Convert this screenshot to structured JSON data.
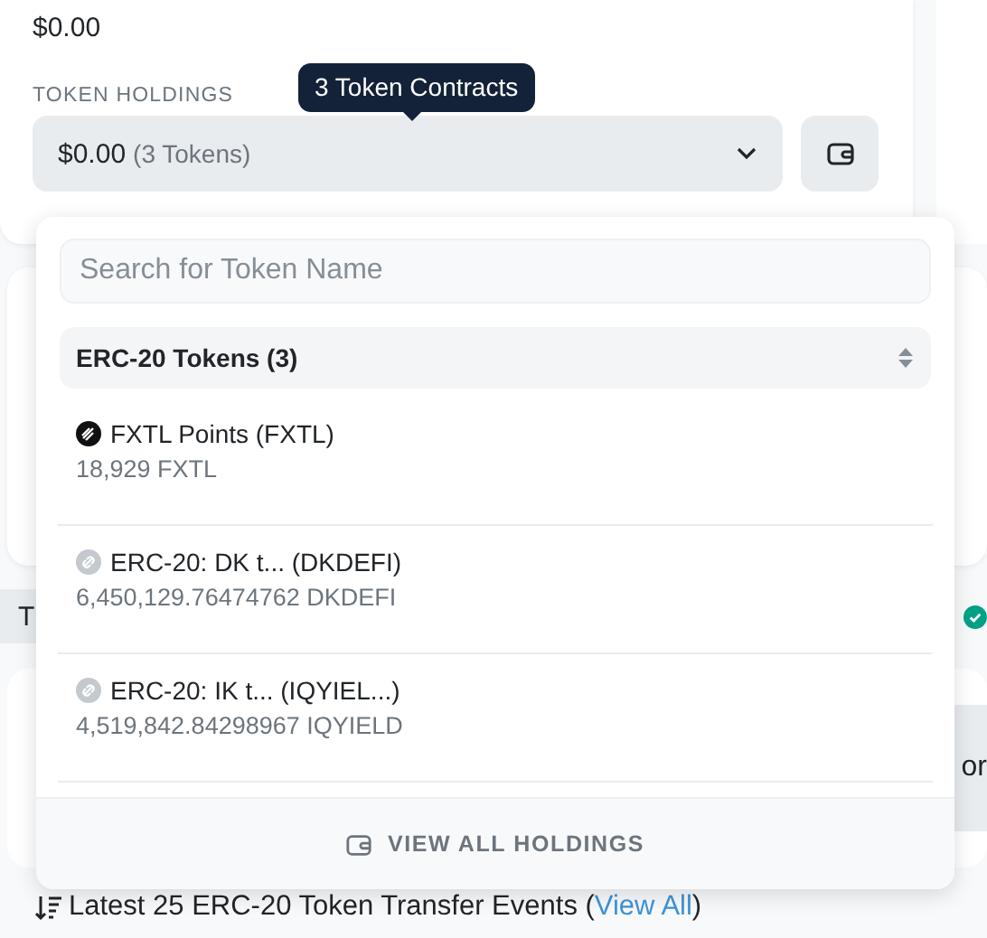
{
  "balance": "$0.00",
  "holdings": {
    "label": "TOKEN HOLDINGS",
    "value": "$0.00",
    "count": "(3 Tokens)",
    "tooltip": "3 Token Contracts",
    "expanded": true
  },
  "dropdown": {
    "search": {
      "placeholder": "Search for Token Name"
    },
    "group": {
      "title": "ERC-20 Tokens (3)"
    },
    "tokens": [
      {
        "name": "FXTL Points (FXTL)",
        "amount": "18,929 FXTL",
        "kind": "logo"
      },
      {
        "name": "ERC-20: DK t... (DKDEFI)",
        "amount": "6,450,129.76474762 DKDEFI",
        "kind": "generic"
      },
      {
        "name": "ERC-20: IK t... (IQYIEL...)",
        "amount": "4,519,842.84298967 IQYIELD",
        "kind": "generic"
      }
    ],
    "footer": "VIEW ALL HOLDINGS"
  },
  "background": {
    "tab_fragment": "T",
    "text_fragment": "or"
  },
  "transfers": {
    "text": "Latest 25 ERC-20 Token Transfer Events (",
    "link": "View All",
    "close": ")"
  }
}
